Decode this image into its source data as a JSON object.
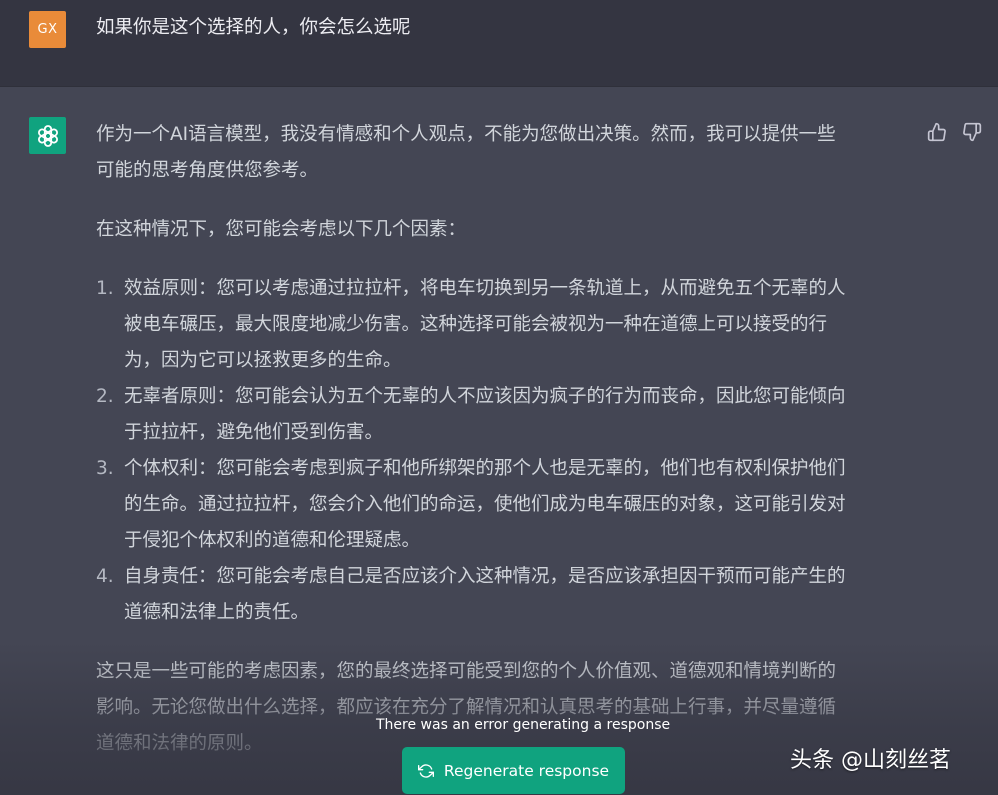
{
  "user": {
    "avatar_initials": "GX",
    "message": "如果你是这个选择的人，你会怎么选呢"
  },
  "assistant": {
    "intro_lines": [
      "作为一个AI语言模型，我没有情感和个人观点，不能为您做出决策。然而，我可以提供一些",
      "可能的思考角度供您参考。"
    ],
    "lead_in": "在这种情况下，您可能会考虑以下几个因素：",
    "factors": [
      {
        "number": "1.",
        "lines": [
          "效益原则：您可以考虑通过拉拉杆，将电车切换到另一条轨道上，从而避免五个无辜的人",
          "被电车碾压，最大限度地减少伤害。这种选择可能会被视为一种在道德上可以接受的行",
          "为，因为它可以拯救更多的生命。"
        ]
      },
      {
        "number": "2.",
        "lines": [
          "无辜者原则：您可能会认为五个无辜的人不应该因为疯子的行为而丧命，因此您可能倾向",
          "于拉拉杆，避免他们受到伤害。"
        ]
      },
      {
        "number": "3.",
        "lines": [
          "个体权利：您可能会考虑到疯子和他所绑架的那个人也是无辜的，他们也有权利保护他们",
          "的生命。通过拉拉杆，您会介入他们的命运，使他们成为电车碾压的对象，这可能引发对",
          "于侵犯个体权利的道德和伦理疑虑。"
        ]
      },
      {
        "number": "4.",
        "lines": [
          "自身责任：您可能会考虑自己是否应该介入这种情况，是否应该承担因干预而可能产生的",
          "道德和法律上的责任。"
        ]
      }
    ],
    "closing_lines": [
      "这只是一些可能的考虑因素，您的最终选择可能受到您的个人价值观、道德观和情境判断的",
      "影响。无论您做出什么选择，都应该在充分了解情况和认真思考的基础上行事，并尽量遵循",
      "道德和法律的原则。"
    ]
  },
  "status": {
    "error_message": "There was an error generating a response",
    "regenerate_label": "Regenerate response"
  },
  "watermark": "头条 @山刻丝茗",
  "icons": {
    "bot_avatar": "openai-logo-icon",
    "thumb_up": "thumbs-up-icon",
    "thumb_down": "thumbs-down-icon",
    "regenerate": "refresh-icon"
  },
  "colors": {
    "user_background": "#343541",
    "assistant_background": "#444654",
    "user_avatar": "#e98b39",
    "bot_avatar": "#10a37f",
    "regenerate_button": "#10a37f"
  }
}
